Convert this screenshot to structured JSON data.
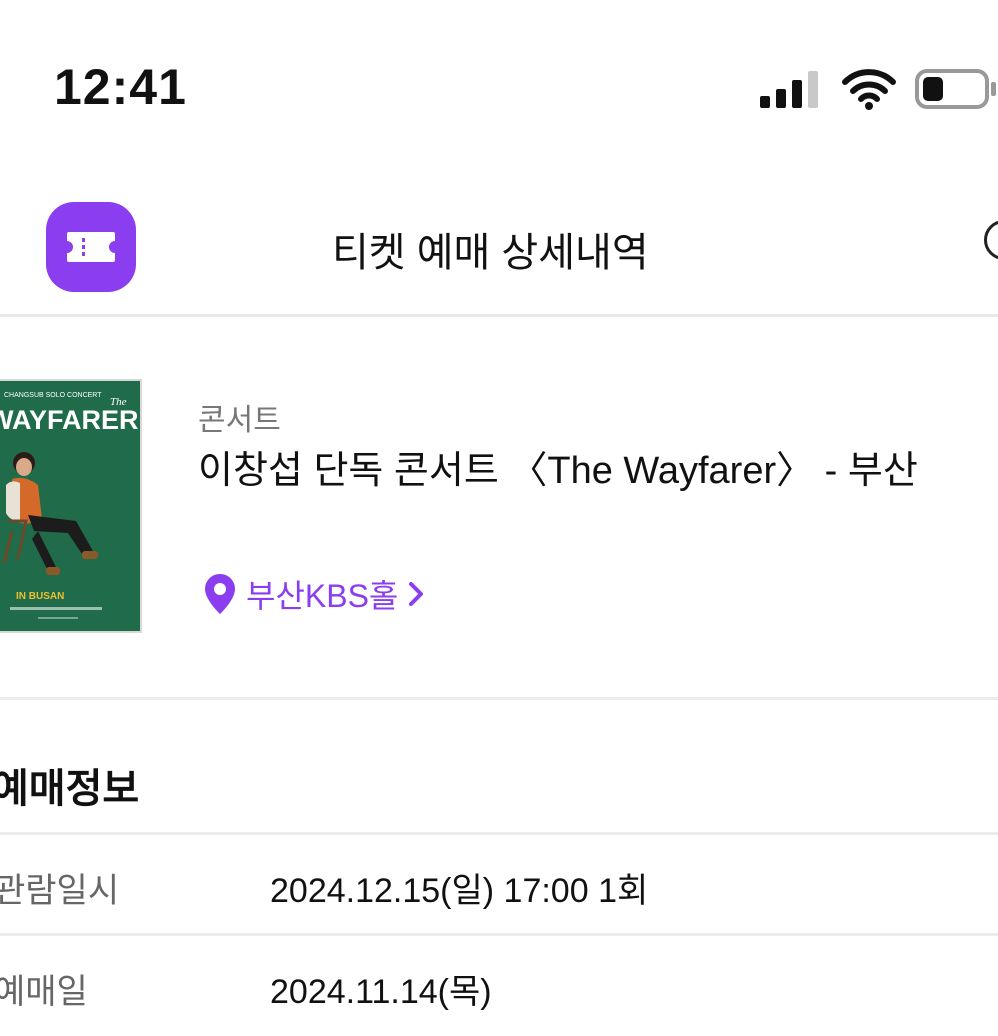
{
  "status_bar": {
    "time": "12:41",
    "icons": [
      "cellular-signal-icon",
      "wifi-icon",
      "battery-icon"
    ]
  },
  "header": {
    "title": "티켓 예매 상세내역",
    "app_icon": "ticket-icon",
    "help_icon": "help-circle-icon"
  },
  "event": {
    "category": "콘서트",
    "title": "이창섭 단독 콘서트 〈The Wayfarer〉 - 부산",
    "venue": "부산KBS홀",
    "poster": {
      "top_text": "CHANGSUB SOLO CONCERT",
      "the": "The",
      "headline": "WAYFARER",
      "location_text": "IN BUSAN"
    }
  },
  "booking": {
    "section_title": "예매정보",
    "rows": [
      {
        "label": "관람일시",
        "value": "2024.12.15(일) 17:00 1회"
      },
      {
        "label": "예매일",
        "value": "2024.11.14(목)"
      }
    ]
  },
  "colors": {
    "accent": "#8b3df0",
    "poster_bg": "#1f6b4a",
    "divider": "#ececec"
  }
}
